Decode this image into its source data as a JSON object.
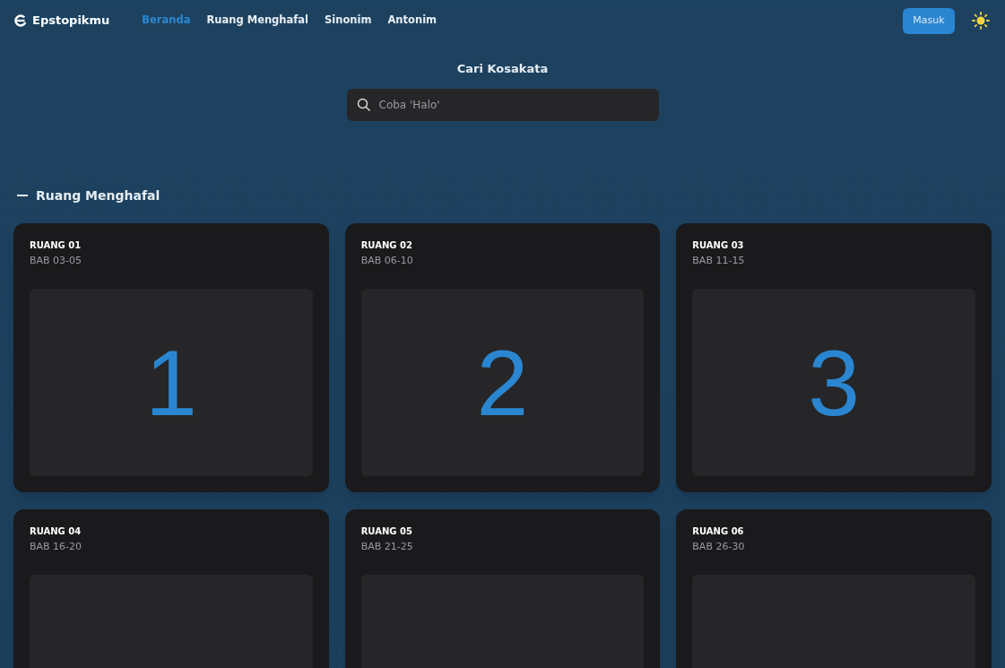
{
  "header": {
    "logo": "Epstopikmu",
    "nav": [
      {
        "label": "Beranda",
        "selected": true
      },
      {
        "label": "Ruang Menghafal",
        "selected": false
      },
      {
        "label": "Sinonim",
        "selected": false
      },
      {
        "label": "Antonim",
        "selected": false
      }
    ],
    "login_button": "Masuk"
  },
  "search": {
    "title": "Cari Kosakata",
    "placeholder": "Coba 'Halo'"
  },
  "section": {
    "title": "Ruang Menghafal"
  },
  "rooms": [
    {
      "title": "RUANG 01",
      "subtitle": "BAB 03-05",
      "number": "1"
    },
    {
      "title": "RUANG 02",
      "subtitle": "BAB 06-10",
      "number": "2"
    },
    {
      "title": "RUANG 03",
      "subtitle": "BAB 11-15",
      "number": "3"
    },
    {
      "title": "RUANG 04",
      "subtitle": "BAB 16-20"
    },
    {
      "title": "RUANG 05",
      "subtitle": "BAB 21-25"
    },
    {
      "title": "RUANG 06",
      "subtitle": "BAB 26-30"
    }
  ]
}
